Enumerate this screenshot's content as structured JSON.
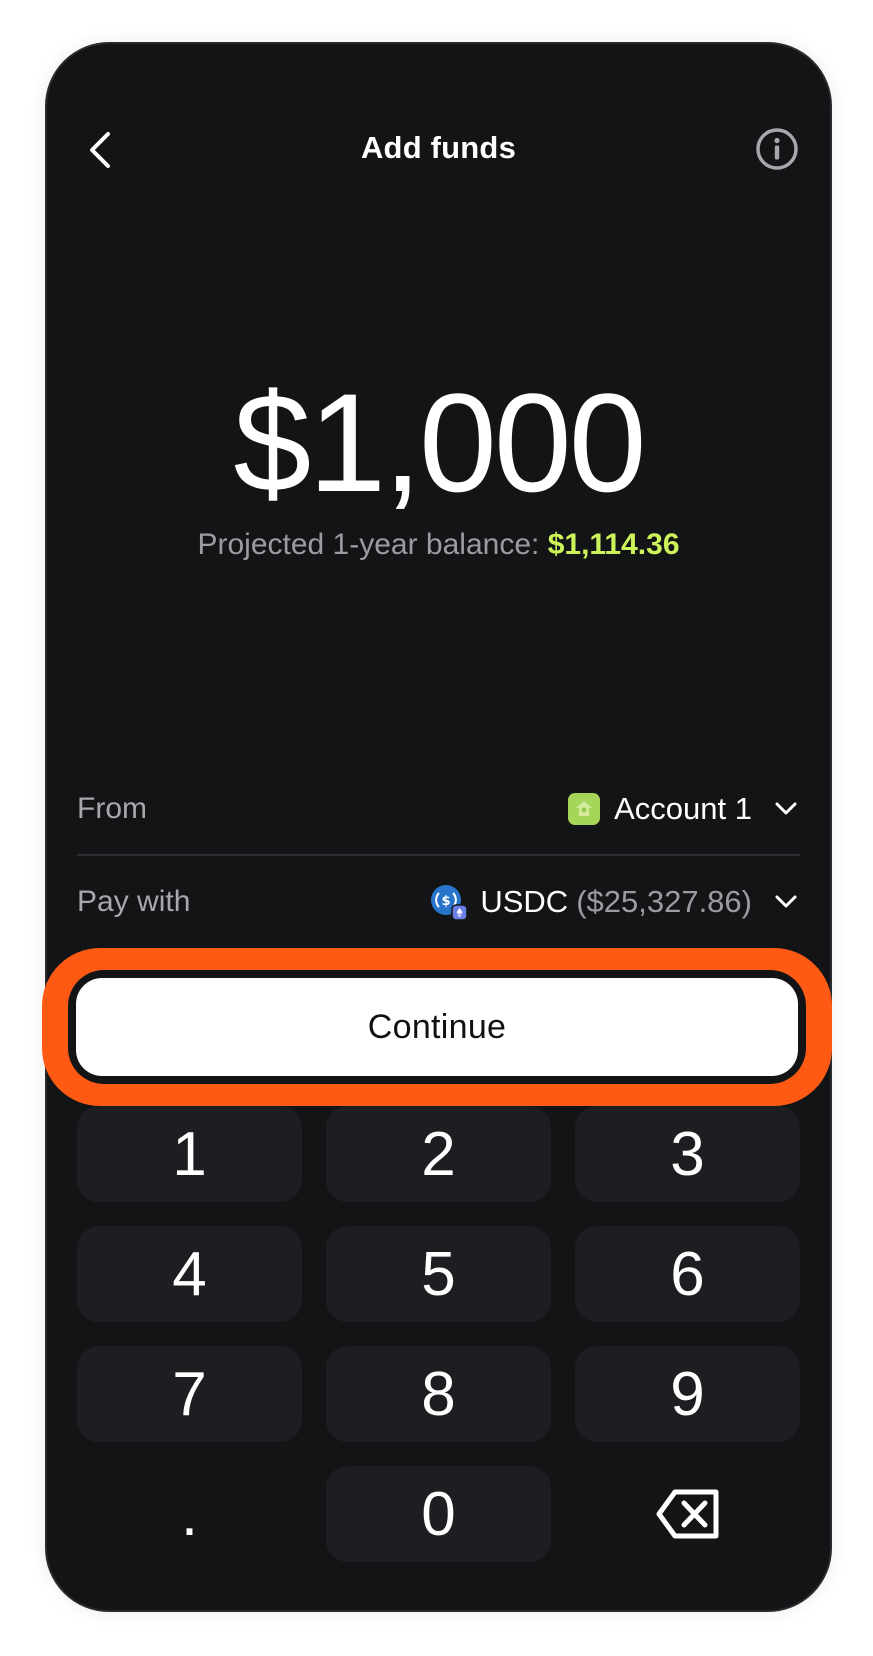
{
  "header": {
    "title": "Add funds",
    "back_icon": "chevron-left-icon",
    "info_icon": "info-icon"
  },
  "amount": {
    "value": "$1,000"
  },
  "projection": {
    "label": "Projected 1-year balance:",
    "value": "$1,114.36"
  },
  "from": {
    "label": "From",
    "account": "Account 1",
    "icon": "account-icon"
  },
  "pay_with": {
    "label": "Pay with",
    "token": "USDC",
    "balance": "($25,327.86)",
    "icon": "usdc-icon"
  },
  "continue": {
    "label": "Continue"
  },
  "keypad": {
    "keys": [
      "1",
      "2",
      "3",
      "4",
      "5",
      "6",
      "7",
      "8",
      "9",
      ".",
      "0"
    ],
    "backspace_icon": "backspace-icon"
  },
  "colors": {
    "background": "#131416",
    "accent_green": "#cdf35a",
    "highlight_orange": "#ff5a14",
    "key_bg": "#1d1e21"
  }
}
